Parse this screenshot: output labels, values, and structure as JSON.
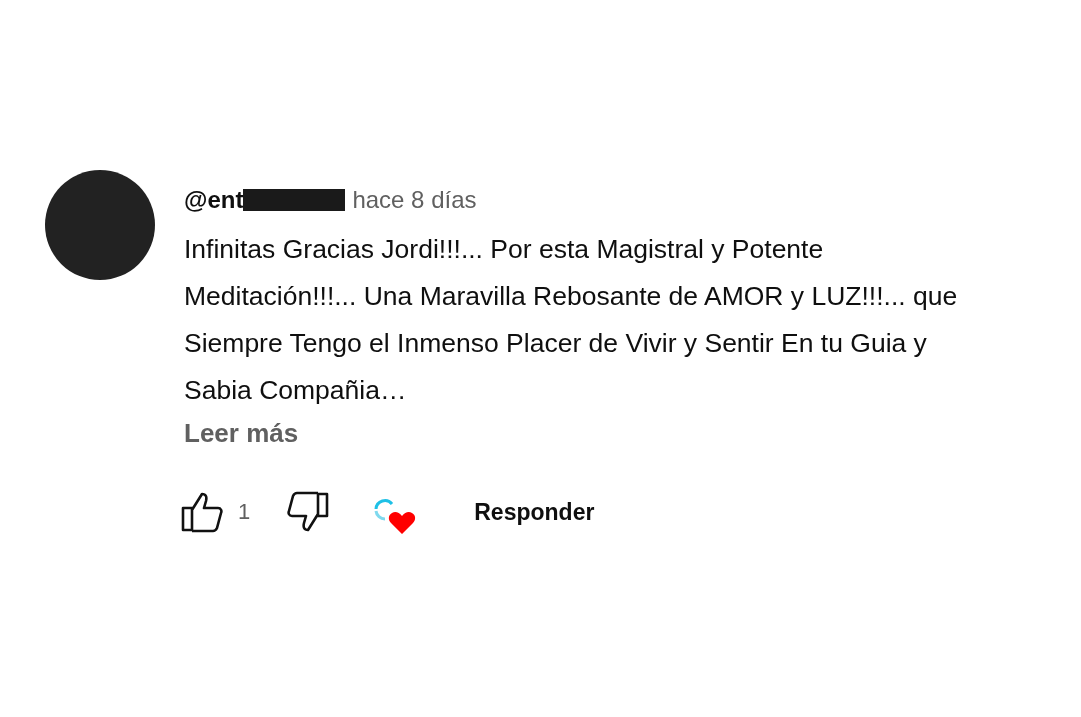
{
  "comment": {
    "author": "@ent",
    "author_redacted": true,
    "time": "hace 8 días",
    "text": "Infinitas Gracias Jordi!!!... Por esta Magistral y Potente Meditación!!!... Una Maravilla Rebosante de AMOR y LUZ!!!... que Siempre Tengo el Inmenso Placer de Vivir y Sentir En tu Guia y Sabia Compañia…",
    "read_more": "Leer más",
    "likes": "1",
    "creator_hearted": true,
    "reply": "Responder"
  }
}
